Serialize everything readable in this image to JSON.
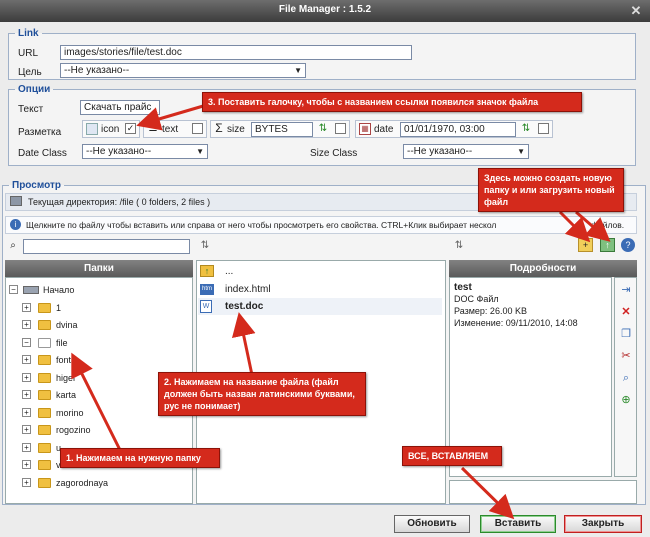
{
  "window": {
    "title": "File Manager : 1.5.2"
  },
  "link": {
    "legend": "Link",
    "url_label": "URL",
    "url_value": "images/stories/file/test.doc",
    "target_label": "Цель",
    "target_value": "--Не указано--"
  },
  "options": {
    "legend": "Опции",
    "text_label": "Текст",
    "text_value": "Скачать прайс",
    "markup_label": "Разметка",
    "icon_label": "icon",
    "text_opt_label": "text",
    "size_label": "size",
    "size_value": "BYTES",
    "date_label": "date",
    "date_value": "01/01/1970, 03:00",
    "date_class_label": "Date Class",
    "date_class_value": "--Не указано--",
    "size_class_label": "Size Class",
    "size_class_value": "--Не указано--"
  },
  "preview": {
    "legend": "Просмотр",
    "current_dir": "Текущая директория: /file ( 0 folders, 2 files )",
    "hint": "Щелкните по файлу чтобы вставить или справа от него чтобы просмотреть его свойства. CTRL+Клик выбирает нескол",
    "hint_tail": "файлов."
  },
  "folders_panel": {
    "header": "Папки",
    "root": "Начало",
    "items": [
      "1",
      "dvina",
      "file",
      "fonts",
      "higer",
      "karta",
      "morino",
      "rogozino",
      "u",
      "v",
      "zagorodnaya"
    ]
  },
  "files_panel": {
    "up": "...",
    "files": [
      "index.html",
      "test.doc"
    ]
  },
  "details_panel": {
    "header": "Подробности",
    "name": "test",
    "type": "DOC Файл",
    "size": "Размер: 26.00 KB",
    "modified": "Изменение: 09/11/2010, 14:08"
  },
  "buttons": {
    "refresh": "Обновить",
    "insert": "Вставить",
    "close": "Закрыть"
  },
  "annotations": {
    "note1": "1. Нажимаем на нужную папку",
    "note2": "2. Нажимаем на название файла (файл должен быть назван латинскими буквами, рус не понимает)",
    "note3": "3. Поставить галочку, чтобы с названием ссылки появился значок файла",
    "note4": "Здесь можно создать новую папку и или загрузить новый файл",
    "note5": "ВСЕ, ВСТАВЛЯЕМ"
  },
  "colors": {
    "annotation_red": "#d42a1c",
    "legend_blue": "#1f4f9a",
    "insert_green": "#2c8a2c",
    "close_red": "#c02020"
  }
}
